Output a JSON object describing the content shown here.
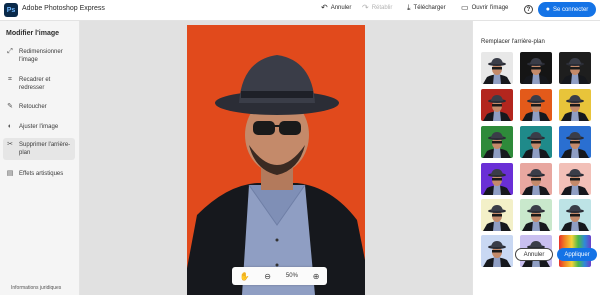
{
  "app": {
    "logo_text": "Ps",
    "title": "Adobe Photoshop Express"
  },
  "toolbar": {
    "undo_label": "Annuler",
    "redo_label": "Rétablir",
    "download_label": "Télécharger",
    "open_image_label": "Ouvrir l'image",
    "help_label": "?",
    "signin_label": "Se connecter"
  },
  "sidebar": {
    "heading": "Modifier l'image",
    "items": [
      {
        "label": "Redimensionner l'image",
        "icon": "resize-icon",
        "active": false
      },
      {
        "label": "Recadrer et redresser",
        "icon": "crop-icon",
        "active": false
      },
      {
        "label": "Retoucher",
        "icon": "retouch-icon",
        "active": false
      },
      {
        "label": "Ajuster l'image",
        "icon": "adjust-icon",
        "active": false
      },
      {
        "label": "Supprimer l'arrière-plan",
        "icon": "remove-background-icon",
        "active": true
      },
      {
        "label": "Effets artistiques",
        "icon": "artistic-effects-icon",
        "active": false
      }
    ],
    "footer": "Informations juridiques"
  },
  "canvas": {
    "zoom_level": "50%",
    "background_color": "#e14a1c"
  },
  "right_panel": {
    "heading": "Remplacer l'arrière-plan",
    "thumbnail_colors": [
      "#e8e8e8",
      "#151515",
      "#1e1e1e",
      "#b3261e",
      "#e35a1a",
      "#e8c43a",
      "#2e8a3a",
      "#1f8a8a",
      "#2a6fd1",
      "#6a2fd6",
      "#e8a7a0",
      "#f2c0b8",
      "#f3f0c8",
      "#c9e8cc",
      "#bde3e6",
      "#c9d8f3",
      "#c9bff0",
      "rainbow"
    ],
    "cancel_label": "Annuler",
    "apply_label": "Appliquer"
  }
}
